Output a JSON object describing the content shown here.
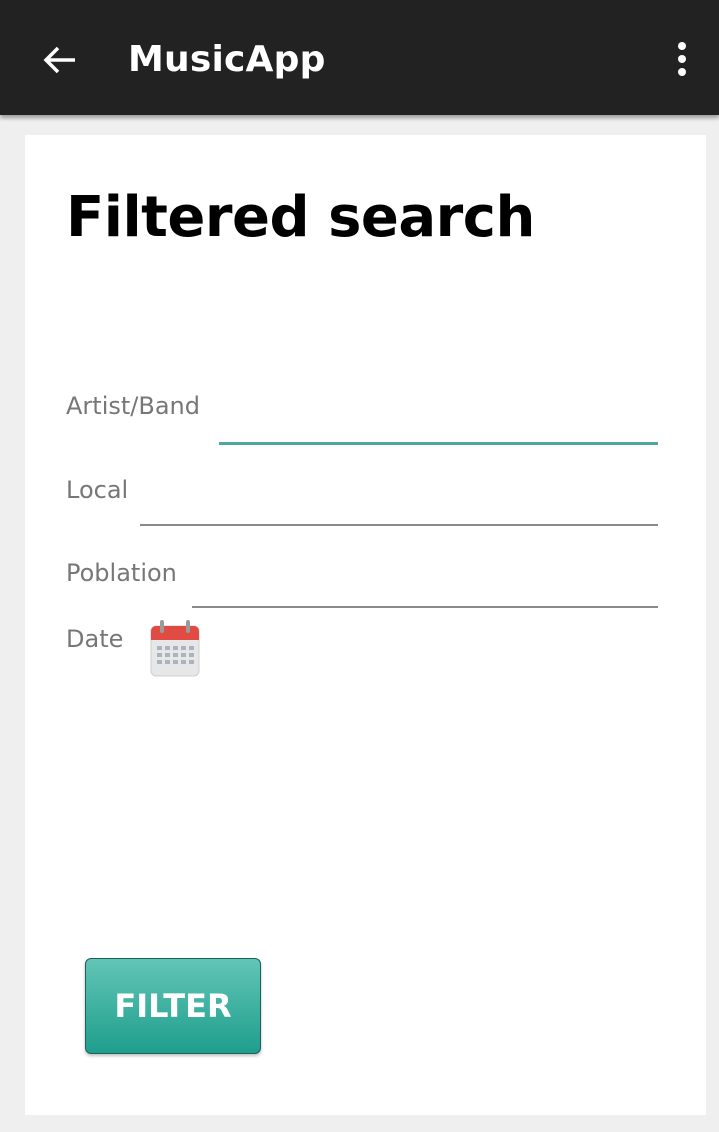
{
  "toolbar": {
    "title": "MusicApp",
    "back_icon": "arrow-left-icon",
    "menu_icon": "more-vert-icon",
    "background_color": "#222222"
  },
  "page": {
    "title": "Filtered search"
  },
  "form": {
    "artist_label": "Artist/Band",
    "artist_value": "",
    "local_label": "Local",
    "local_value": "",
    "poblation_label": "Poblation",
    "poblation_value": "",
    "date_label": "Date",
    "date_icon": "calendar-icon",
    "accent_color": "#4da89a"
  },
  "actions": {
    "filter_label": "FILTER",
    "filter_color": "#26a69a"
  }
}
